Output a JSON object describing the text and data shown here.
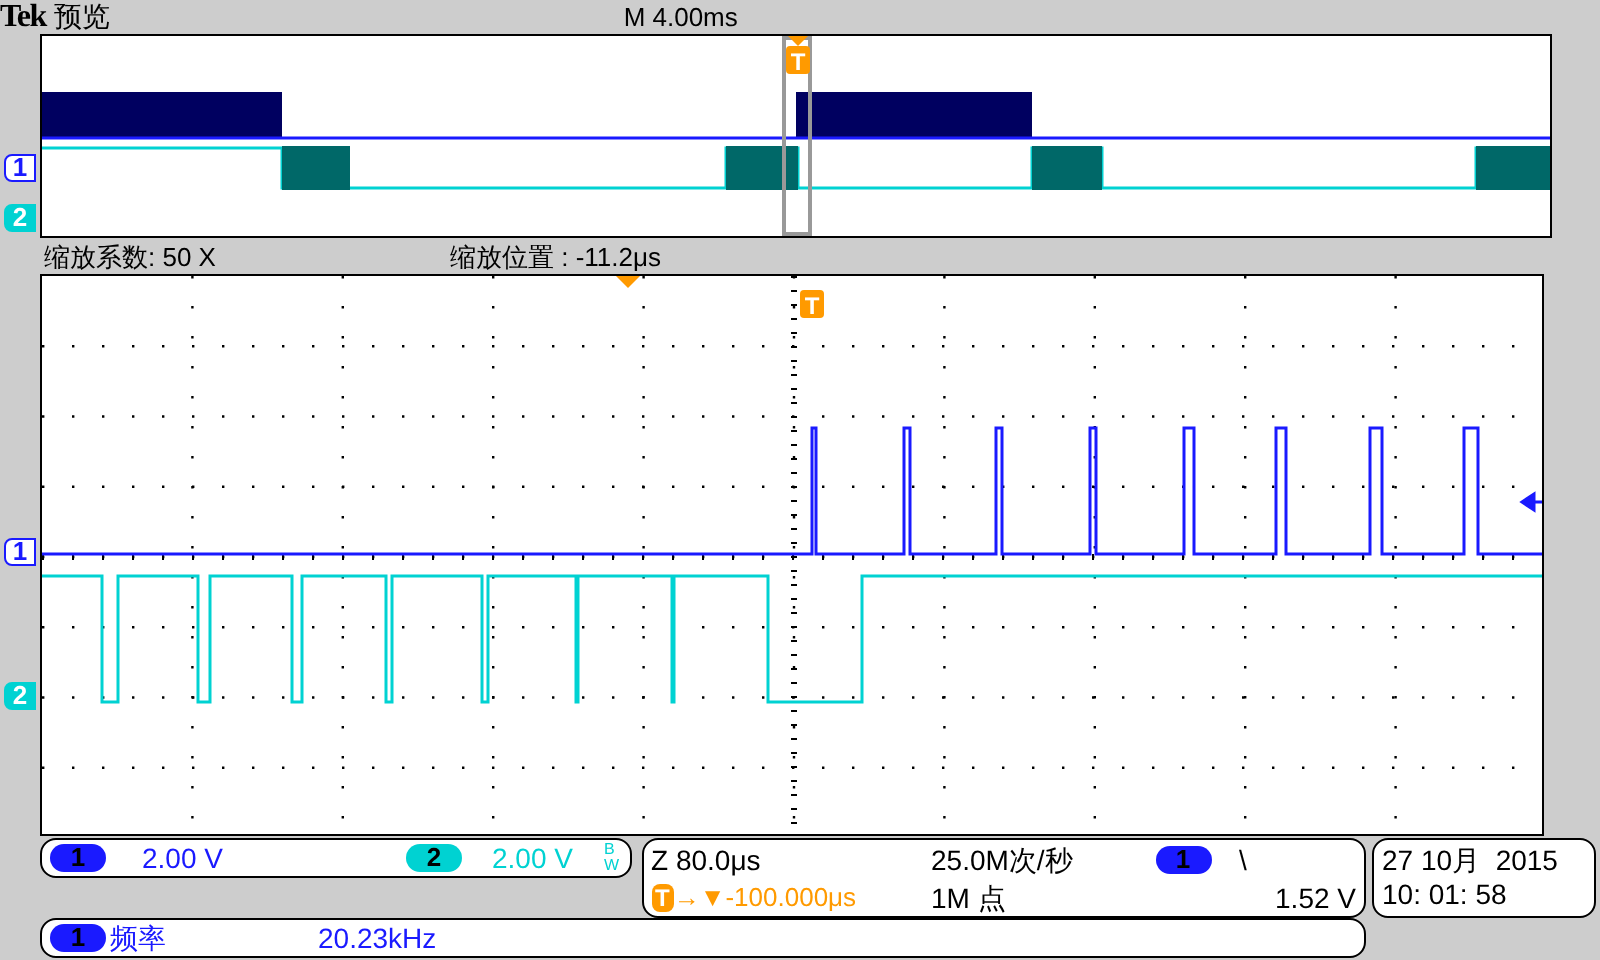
{
  "header": {
    "brand": "Tek",
    "mode": "预览",
    "timebase": "M 4.00ms"
  },
  "overview": {
    "channel_markers": [
      "1",
      "2"
    ],
    "trigger_marker": "T"
  },
  "zoom": {
    "factor": "缩放系数: 50 X",
    "position": "缩放位置 : -11.2μs"
  },
  "main": {
    "channel_markers": [
      "1",
      "2"
    ],
    "trigger_marker": "T"
  },
  "channels": [
    {
      "number": "1",
      "scale": "2.00 V",
      "color": "#1a1aff"
    },
    {
      "number": "2",
      "scale": "2.00 V",
      "color": "#00d2d2",
      "bandwidth_limit": "BW"
    }
  ],
  "horizontal": {
    "scale": "Z 80.0μs",
    "sample_rate": "25.0M次/秒",
    "trigger_badge": "T",
    "trigger_position": "→▼-100.000μs",
    "record_length": "1M 点"
  },
  "trigger": {
    "source": "1",
    "slope": "\\",
    "level": "1.52 V"
  },
  "clock": {
    "date": "27 10月  2015",
    "time": "10: 01: 58"
  },
  "measurement": {
    "source": "1",
    "name": "频率",
    "value": "20.23kHz"
  }
}
